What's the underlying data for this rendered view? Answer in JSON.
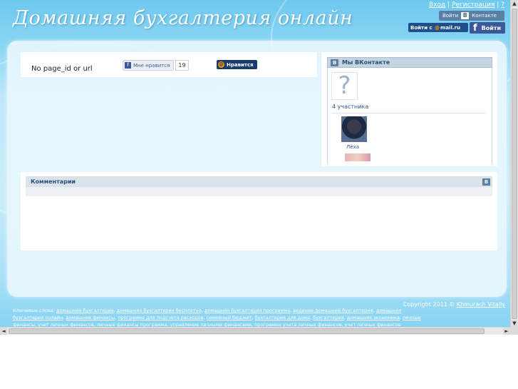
{
  "header": {
    "logo_text": "Домашняя бухгалтерия онлайн",
    "links": {
      "login": "Вход",
      "register": "Регистрация",
      "help": "?",
      "sep": "|"
    },
    "vk_button": {
      "label_left": "Войти",
      "vk_letter": "В",
      "label_right": "Контакте"
    },
    "mail_button": {
      "label": "Войти с",
      "at": "@",
      "brand": "mail.ru"
    },
    "fb_button": {
      "letter": "f",
      "label": "Войти"
    }
  },
  "content": {
    "message": "No page_id or url",
    "fb_like": {
      "icon_letter": "f",
      "label": "Мне нравится",
      "count": "19"
    },
    "mail_like": {
      "at": "@",
      "label": "Нравится"
    }
  },
  "vk_widget": {
    "title": "Мы ВКонтакте",
    "vk_letter": "В",
    "placeholder_glyph": "?",
    "members_count": "4 участника",
    "member_name": "Лёха"
  },
  "comments": {
    "title": "Комментарии",
    "vk_letter": "В"
  },
  "footer": {
    "copyright_prefix": "Copyright 2011 ©",
    "author": "Khmurach Vitaliy",
    "keywords_label": "Ключевые слова:",
    "keywords": [
      "домашняя бухгалтерия",
      "домашняя бухгалтерия бесплатно",
      "домашняя бухгалтерия программа",
      "ведение домашней бухгалтерии",
      "домашняя бухгалтерия онлайн",
      "домашние финансы",
      "программа для подсчета расходов",
      "семейный бюджет",
      "бухгалтерия для дома",
      "бухгалтерия",
      "домашняя экономика",
      "личные финансы",
      "учет личных финансов",
      "личные финансы программа",
      "управление личными финансами",
      "программа учета личных финансов",
      "учет личных финансов"
    ]
  },
  "scrollbars": {
    "up": "▲",
    "down": "▼",
    "left": "◄",
    "right": "►"
  },
  "colors": {
    "sky": "#8ad6f4",
    "vk_blue": "#5a7fa5",
    "fb_blue": "#3b5998",
    "mail_navy": "#1f4f8a",
    "mail_orange": "#ff9a00"
  }
}
